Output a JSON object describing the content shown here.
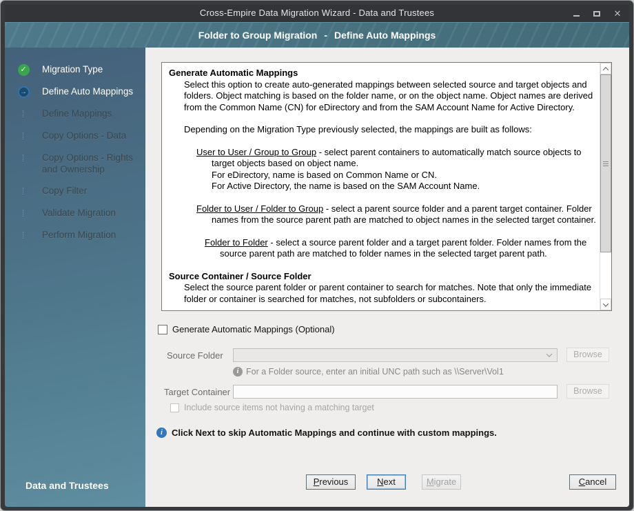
{
  "window": {
    "title": "Cross-Empire Data Migration Wizard - Data and Trustees",
    "controls": {
      "close_glyph": "✕"
    }
  },
  "header": {
    "title_left": "Folder to Group Migration",
    "separator": "-",
    "title_right": "Define Auto Mappings"
  },
  "sidebar": {
    "steps": [
      {
        "label": "Migration Type",
        "status": "completed"
      },
      {
        "label": "Define Auto Mappings",
        "status": "current"
      },
      {
        "label": "Define Mappings",
        "status": "pending"
      },
      {
        "label": "Copy Options - Data",
        "status": "pending"
      },
      {
        "label": "Copy Options - Rights and Ownership",
        "status": "pending"
      },
      {
        "label": "Copy Filter",
        "status": "pending"
      },
      {
        "label": "Validate Migration",
        "status": "pending"
      },
      {
        "label": "Perform Migration",
        "status": "pending"
      }
    ],
    "footer": "Data and Trustees"
  },
  "infobox": {
    "heading1": "Generate Automatic Mappings",
    "para1": "Select this option to create auto-generated mappings between selected source and target objects and folders.  Object matching is based on the folder name, or on the object name.  Object names are derived from the Common Name (CN) for eDirectory and from the SAM Account Name for Active Directory.",
    "para2": "Depending on the Migration Type previously selected, the mappings are built as follows:",
    "entries": [
      {
        "term": "User to User / Group to Group",
        "desc": "  -  select parent containers to automatically match source objects to target objects based on object name.",
        "lines": [
          "For eDirectory, name is based on Common Name or CN.",
          "For Active Directory, the name is based on the SAM Account Name."
        ]
      },
      {
        "term": "Folder to User / Folder to Group",
        "desc": "  -  select a parent source folder and a parent target container.  Folder names from the source parent path are matched to object names in the selected target container.",
        "lines": []
      },
      {
        "term": "Folder to Folder",
        "desc": "  -  select a source parent folder and a target parent folder.  Folder names from the source parent path are matched to folder names in the selected target parent path.",
        "lines": []
      }
    ],
    "heading2": "Source Container / Source Folder",
    "para3": "Select the source parent folder or parent container to search for matches.  Note that only the immediate folder or container is searched for matches, not subfolders or subcontainers."
  },
  "form": {
    "generate_checkbox_label": "Generate Automatic Mappings  (Optional)",
    "source_folder_label": "Source Folder",
    "source_folder_value": "",
    "source_browse_label": "Browse",
    "source_hint": "For a Folder source, enter an initial UNC path such as \\\\Server\\Vol1",
    "target_container_label": "Target Container",
    "target_container_value": "",
    "target_browse_label": "Browse",
    "include_checkbox_label": "Include source items not having a matching target",
    "note": "Click Next to skip Automatic Mappings and continue with custom mappings."
  },
  "buttons": {
    "previous": {
      "key": "P",
      "rest": "revious"
    },
    "next": {
      "key": "N",
      "rest": "ext"
    },
    "migrate": {
      "key": "M",
      "rest": "igrate"
    },
    "cancel": {
      "key": "C",
      "rest": "ancel"
    }
  },
  "colors": {
    "header_teal": "#4a7584",
    "completed_green": "#3ba54e",
    "current_blue": "#2c74b0",
    "note_blue": "#2e78bb"
  }
}
